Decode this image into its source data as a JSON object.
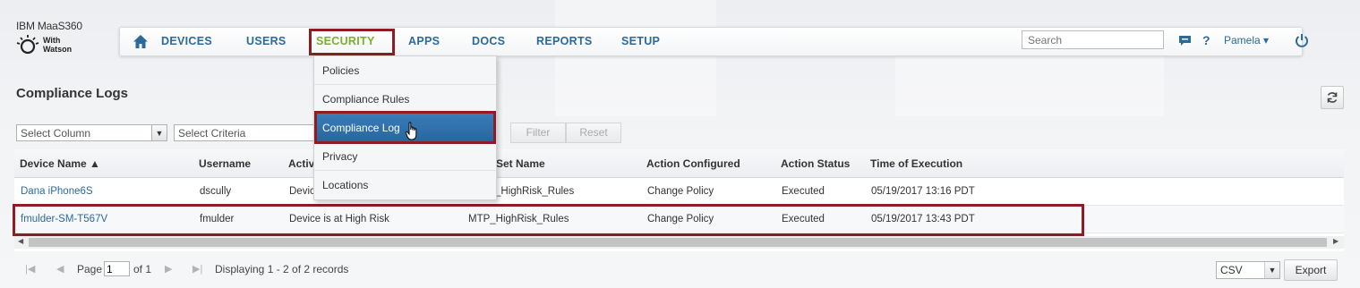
{
  "logo": {
    "title": "IBM MaaS360",
    "subtitle_line1": "With",
    "subtitle_line2": "Watson"
  },
  "nav": {
    "items": [
      {
        "label": "DEVICES"
      },
      {
        "label": "USERS"
      },
      {
        "label": "SECURITY",
        "active": true
      },
      {
        "label": "APPS"
      },
      {
        "label": "DOCS"
      },
      {
        "label": "REPORTS"
      },
      {
        "label": "SETUP"
      }
    ],
    "search_placeholder": "Search",
    "user_name": "Pamela ▾",
    "help_label": "?"
  },
  "security_menu": {
    "items": [
      {
        "label": "Policies"
      },
      {
        "label": "Compliance Rules"
      },
      {
        "label": "Compliance Log",
        "active": true
      },
      {
        "label": "Privacy"
      },
      {
        "label": "Locations"
      }
    ]
  },
  "page": {
    "title": "Compliance Logs"
  },
  "filters": {
    "column_placeholder": "Select Column",
    "criteria_placeholder": "Select Criteria",
    "filter_label": "Filter",
    "reset_label": "Reset"
  },
  "grid": {
    "headers": [
      "Device Name ▲",
      "Username",
      "Activ",
      "Set Name",
      "Action Configured",
      "Action Status",
      "Time of Execution"
    ],
    "rows": [
      {
        "device": "Dana iPhone6S",
        "username": "dscully",
        "activity": "Devic",
        "rule_set": "_HighRisk_Rules",
        "action": "Change Policy",
        "status": "Executed",
        "time": "05/19/2017 13:16 PDT"
      },
      {
        "device": "fmulder-SM-T567V",
        "username": "fmulder",
        "activity": "Device is at High Risk",
        "rule_set": "MTP_HighRisk_Rules",
        "action": "Change Policy",
        "status": "Executed",
        "time": "05/19/2017 13:43 PDT"
      }
    ]
  },
  "pager": {
    "page_label": "Page",
    "page_value": "1",
    "of_label": "of 1",
    "displaying": "Displaying 1 - 2 of 2 records",
    "export_format": "CSV",
    "export_label": "Export"
  },
  "colors": {
    "nav_link": "#2c6a9a",
    "active_nav": "#7cae2e",
    "highlight_border": "#8e1c22",
    "menu_active": "#2966a0"
  }
}
